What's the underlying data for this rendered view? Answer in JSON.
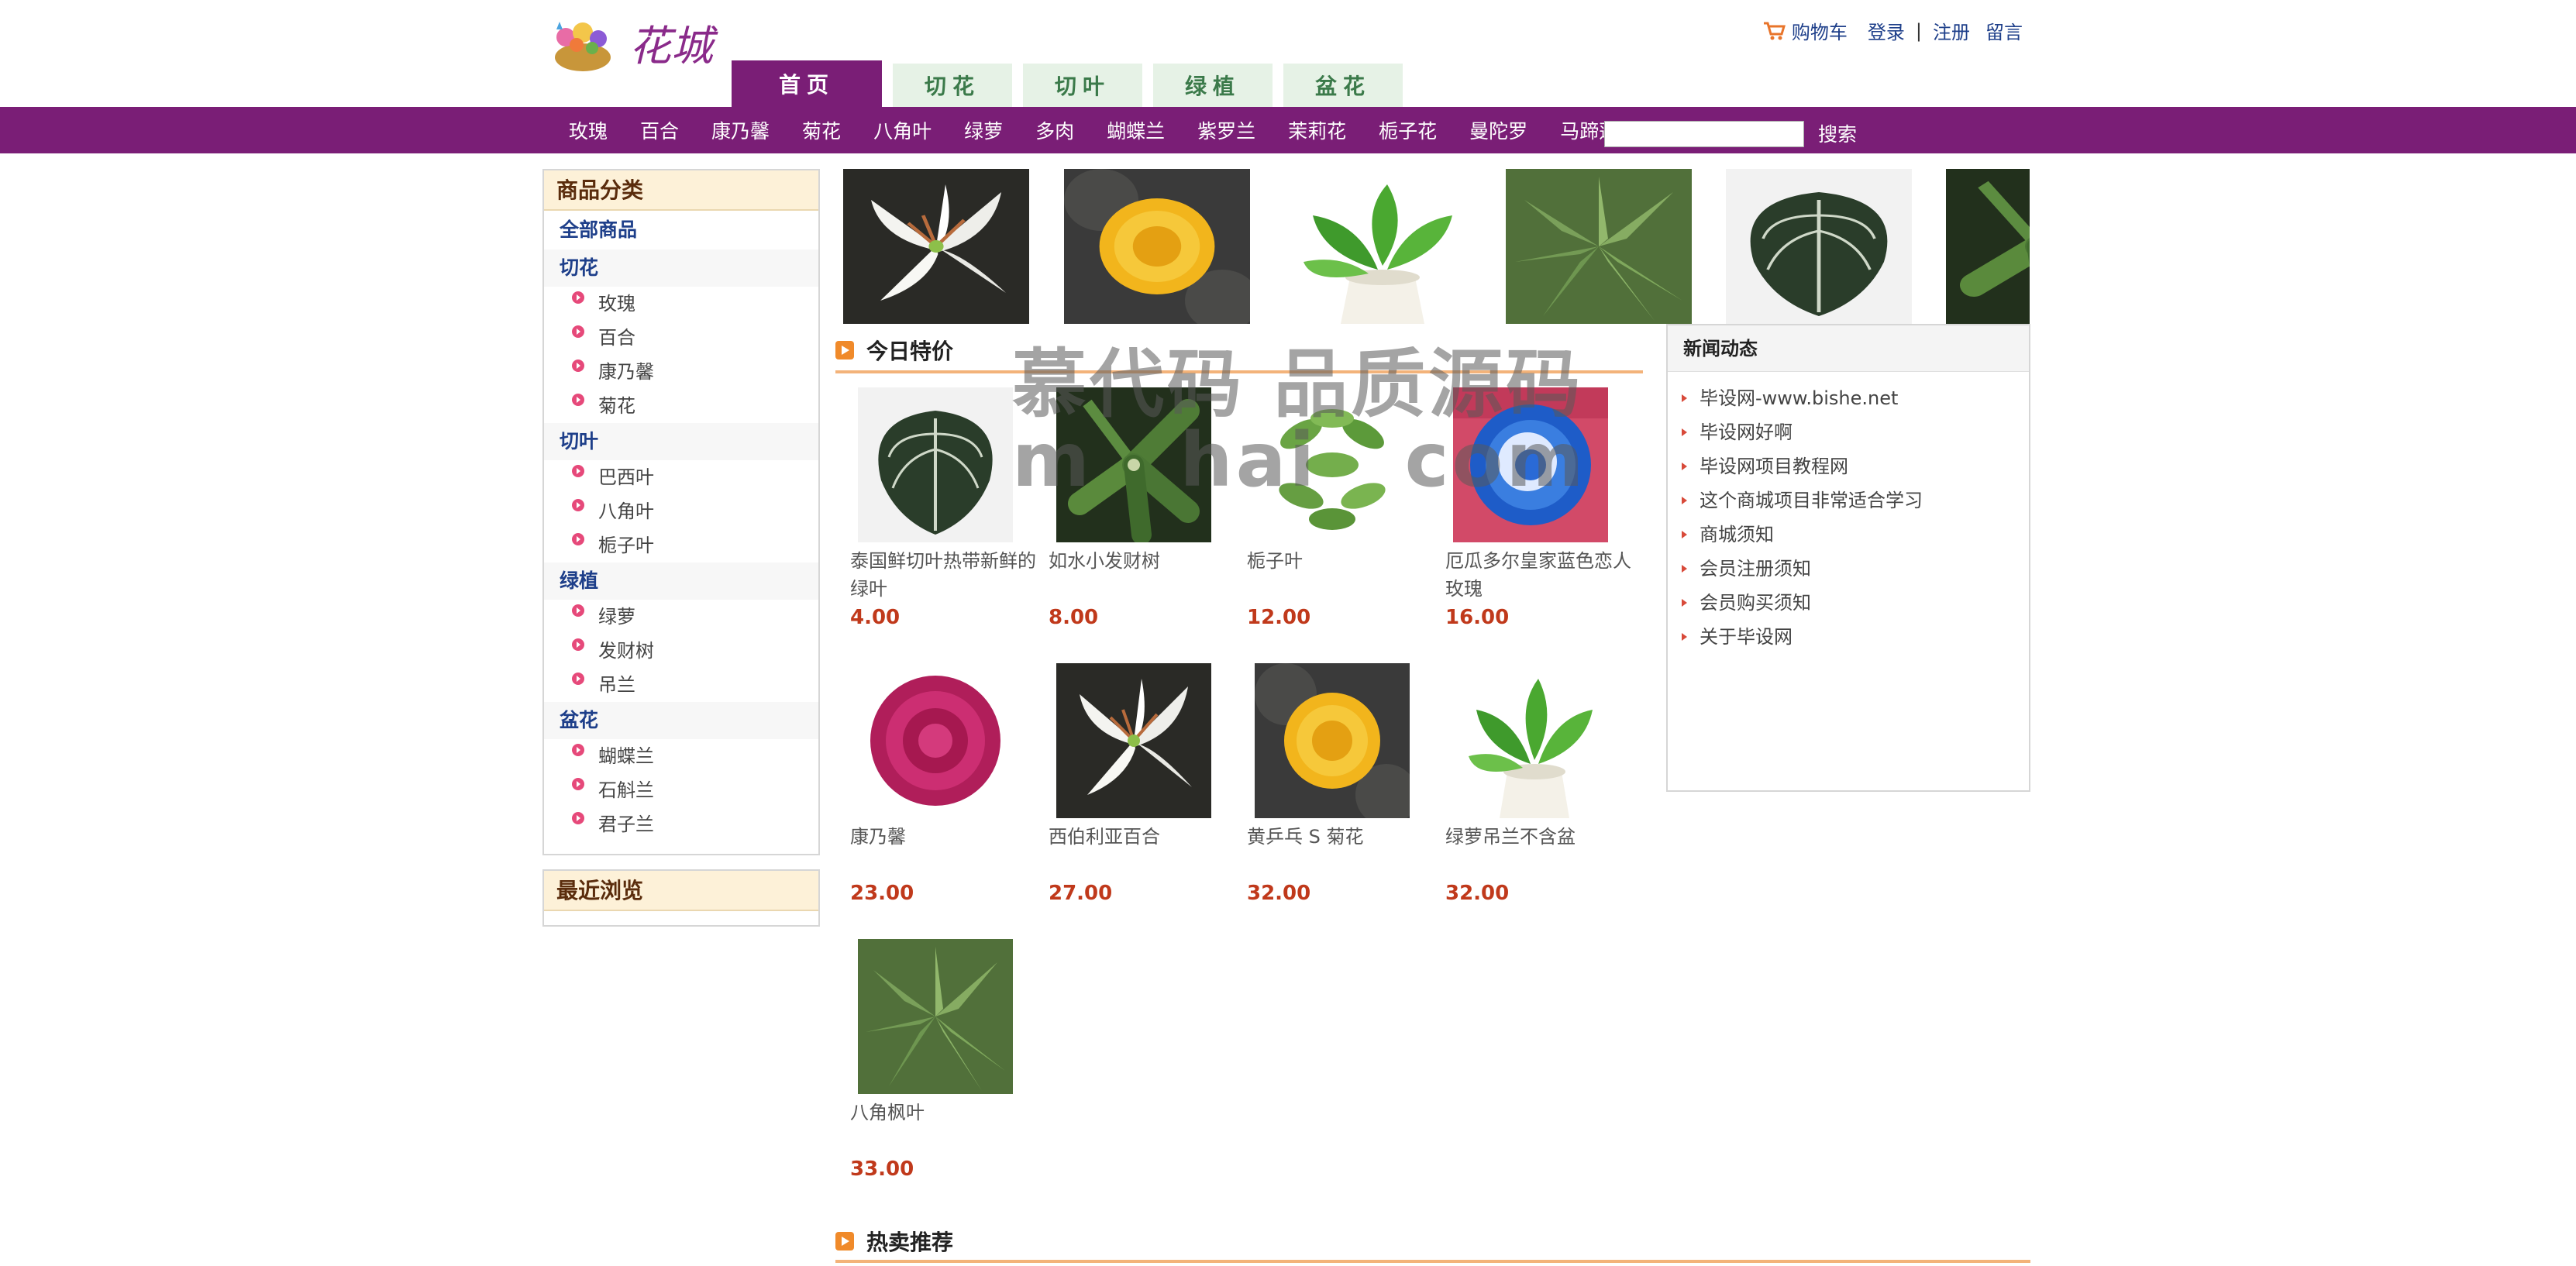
{
  "header": {
    "logo_text": "花城",
    "links": {
      "cart": "购物车",
      "login": "登录",
      "separator": "|",
      "register": "注册",
      "message": "留言"
    }
  },
  "tabs": [
    {
      "label": "首页",
      "active": true
    },
    {
      "label": "切花",
      "active": false
    },
    {
      "label": "切叶",
      "active": false
    },
    {
      "label": "绿植",
      "active": false
    },
    {
      "label": "盆花",
      "active": false
    }
  ],
  "catbar": {
    "links": [
      "玫瑰",
      "百合",
      "康乃馨",
      "菊花",
      "八角叶",
      "绿萝",
      "多肉",
      "蝴蝶兰",
      "紫罗兰",
      "茉莉花",
      "栀子花",
      "曼陀罗",
      "马蹄莲"
    ],
    "search_placeholder": "",
    "search_label": "搜索"
  },
  "sidebar": {
    "title": "商品分类",
    "all": "全部商品",
    "groups": [
      {
        "name": "切花",
        "items": [
          "玫瑰",
          "百合",
          "康乃馨",
          "菊花"
        ]
      },
      {
        "name": "切叶",
        "items": [
          "巴西叶",
          "八角叶",
          "栀子叶"
        ]
      },
      {
        "name": "绿植",
        "items": [
          "绿萝",
          "发财树",
          "吊兰"
        ]
      },
      {
        "name": "盆花",
        "items": [
          "蝴蝶兰",
          "石斛兰",
          "君子兰"
        ]
      }
    ],
    "recent_title": "最近浏览"
  },
  "strip_images": [
    "lily-image",
    "chrysanthemum-image",
    "pothos-image",
    "maple-leaf-image",
    "anthurium-leaf-image",
    "money-tree-image"
  ],
  "specials": {
    "title": "今日特价",
    "products": [
      {
        "name": "泰国鲜切叶热带新鲜的绿叶",
        "price": "4.00",
        "img": "anthurium-leaf-image"
      },
      {
        "name": "如水小发财树",
        "price": "8.00",
        "img": "money-tree-image"
      },
      {
        "name": "栀子叶",
        "price": "12.00",
        "img": "gardenia-leaf-image"
      },
      {
        "name": "厄瓜多尔皇家蓝色恋人玫瑰",
        "price": "16.00",
        "img": "blue-rose-image"
      },
      {
        "name": "康乃馨",
        "price": "23.00",
        "img": "carnation-image"
      },
      {
        "name": "西伯利亚百合",
        "price": "27.00",
        "img": "lily-image"
      },
      {
        "name": "黄乒乓 S 菊花",
        "price": "32.00",
        "img": "chrysanthemum-image"
      },
      {
        "name": "绿萝吊兰不含盆",
        "price": "32.00",
        "img": "pothos-image"
      },
      {
        "name": "八角枫叶",
        "price": "33.00",
        "img": "maple-leaf-image"
      }
    ]
  },
  "news": {
    "title": "新闻动态",
    "items": [
      "毕设网-www.bishe.net",
      "毕设网好啊",
      "毕设网项目教程网",
      "这个商城项目非常适合学习",
      "商城须知",
      "会员注册须知",
      "会员购买须知",
      "关于毕设网"
    ]
  },
  "hot": {
    "title": "热卖推荐"
  },
  "watermark": {
    "line1": "慕代码 品质源码",
    "line2": "m   hai   com"
  },
  "colors": {
    "brand": "#7a1e76",
    "tab_inactive": "#e6f2e6",
    "price": "#c0391b",
    "link": "#1e3f8a",
    "accent": "#f08a2a"
  }
}
